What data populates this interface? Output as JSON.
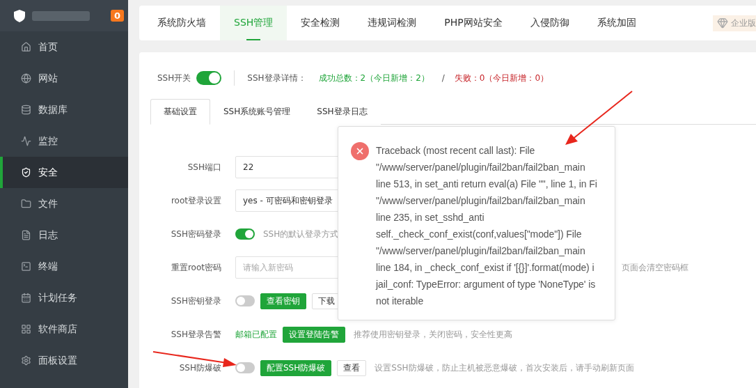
{
  "sidebar": {
    "badge": "0",
    "items": [
      {
        "label": "首页",
        "selected": false
      },
      {
        "label": "网站",
        "selected": false
      },
      {
        "label": "数据库",
        "selected": false
      },
      {
        "label": "监控",
        "selected": false
      },
      {
        "label": "安全",
        "selected": true
      },
      {
        "label": "文件",
        "selected": false
      },
      {
        "label": "日志",
        "selected": false
      },
      {
        "label": "终端",
        "selected": false
      },
      {
        "label": "计划任务",
        "selected": false
      },
      {
        "label": "软件商店",
        "selected": false
      },
      {
        "label": "面板设置",
        "selected": false
      }
    ]
  },
  "tabs": [
    {
      "label": "系统防火墙",
      "selected": false
    },
    {
      "label": "SSH管理",
      "selected": true
    },
    {
      "label": "安全检测",
      "selected": false
    },
    {
      "label": "违规词检测",
      "selected": false
    },
    {
      "label": "PHP网站安全",
      "selected": false
    },
    {
      "label": "入侵防御",
      "selected": false
    },
    {
      "label": "系统加固",
      "selected": false
    }
  ],
  "edition_badge": "企业版",
  "status": {
    "switch_label": "SSH开关",
    "ssh_on": true,
    "details_label": "SSH登录详情：",
    "success": "成功总数：2（今日新增：2）",
    "separator": "/",
    "failure": "失败：0（今日新增：0）"
  },
  "subtabs": [
    {
      "label": "基础设置",
      "selected": true
    },
    {
      "label": "SSH系统账号管理",
      "selected": false
    },
    {
      "label": "SSH登录日志",
      "selected": false
    }
  ],
  "form": [
    {
      "kind": "input",
      "label": "SSH端口",
      "value": "22"
    },
    {
      "kind": "input",
      "label": "root登录设置",
      "value": "yes - 可密码和密钥登录"
    },
    {
      "kind": "toggle",
      "label": "SSH密码登录",
      "on": true,
      "hint": "SSH的默认登录方式"
    },
    {
      "kind": "input",
      "label": "重置root密码",
      "placeholder": "请输入新密码",
      "hint": "页面会清空密码框"
    },
    {
      "kind": "toggle",
      "label": "SSH密钥登录",
      "on": false,
      "buttons": [
        {
          "label": "查看密钥",
          "kind": "primary"
        },
        {
          "label": "下载",
          "kind": "plain"
        }
      ]
    },
    {
      "kind": "status",
      "label": "SSH登录告警",
      "status": "邮箱已配置",
      "buttons": [
        {
          "label": "设置登陆告警",
          "kind": "primary"
        }
      ],
      "hint": "推荐使用密钥登录，关闭密码，安全性更高"
    },
    {
      "kind": "toggle",
      "label": "SSH防爆破",
      "on": false,
      "buttons": [
        {
          "label": "配置SSH防爆破",
          "kind": "primary"
        },
        {
          "label": "查看",
          "kind": "plain"
        }
      ],
      "hint": "设置SSH防爆破，防止主机被恶意爆破，首次安装后，请手动刷新页面"
    }
  ],
  "error_popup": {
    "lines": [
      "Traceback (most recent call last): File",
      "\"/www/server/panel/plugin/fail2ban/fail2ban_main",
      "line 513, in set_anti return eval(a) File \"\", line 1, in Fi",
      "\"/www/server/panel/plugin/fail2ban/fail2ban_main",
      "line 235, in set_sshd_anti",
      "self._check_conf_exist(conf,values[\"mode\"]) File",
      "\"/www/server/panel/plugin/fail2ban/fail2ban_main",
      "line 184, in _check_conf_exist if '[{}]'.format(mode) i",
      "jail_conf: TypeError: argument of type 'NoneType' is",
      "not iterable"
    ]
  }
}
